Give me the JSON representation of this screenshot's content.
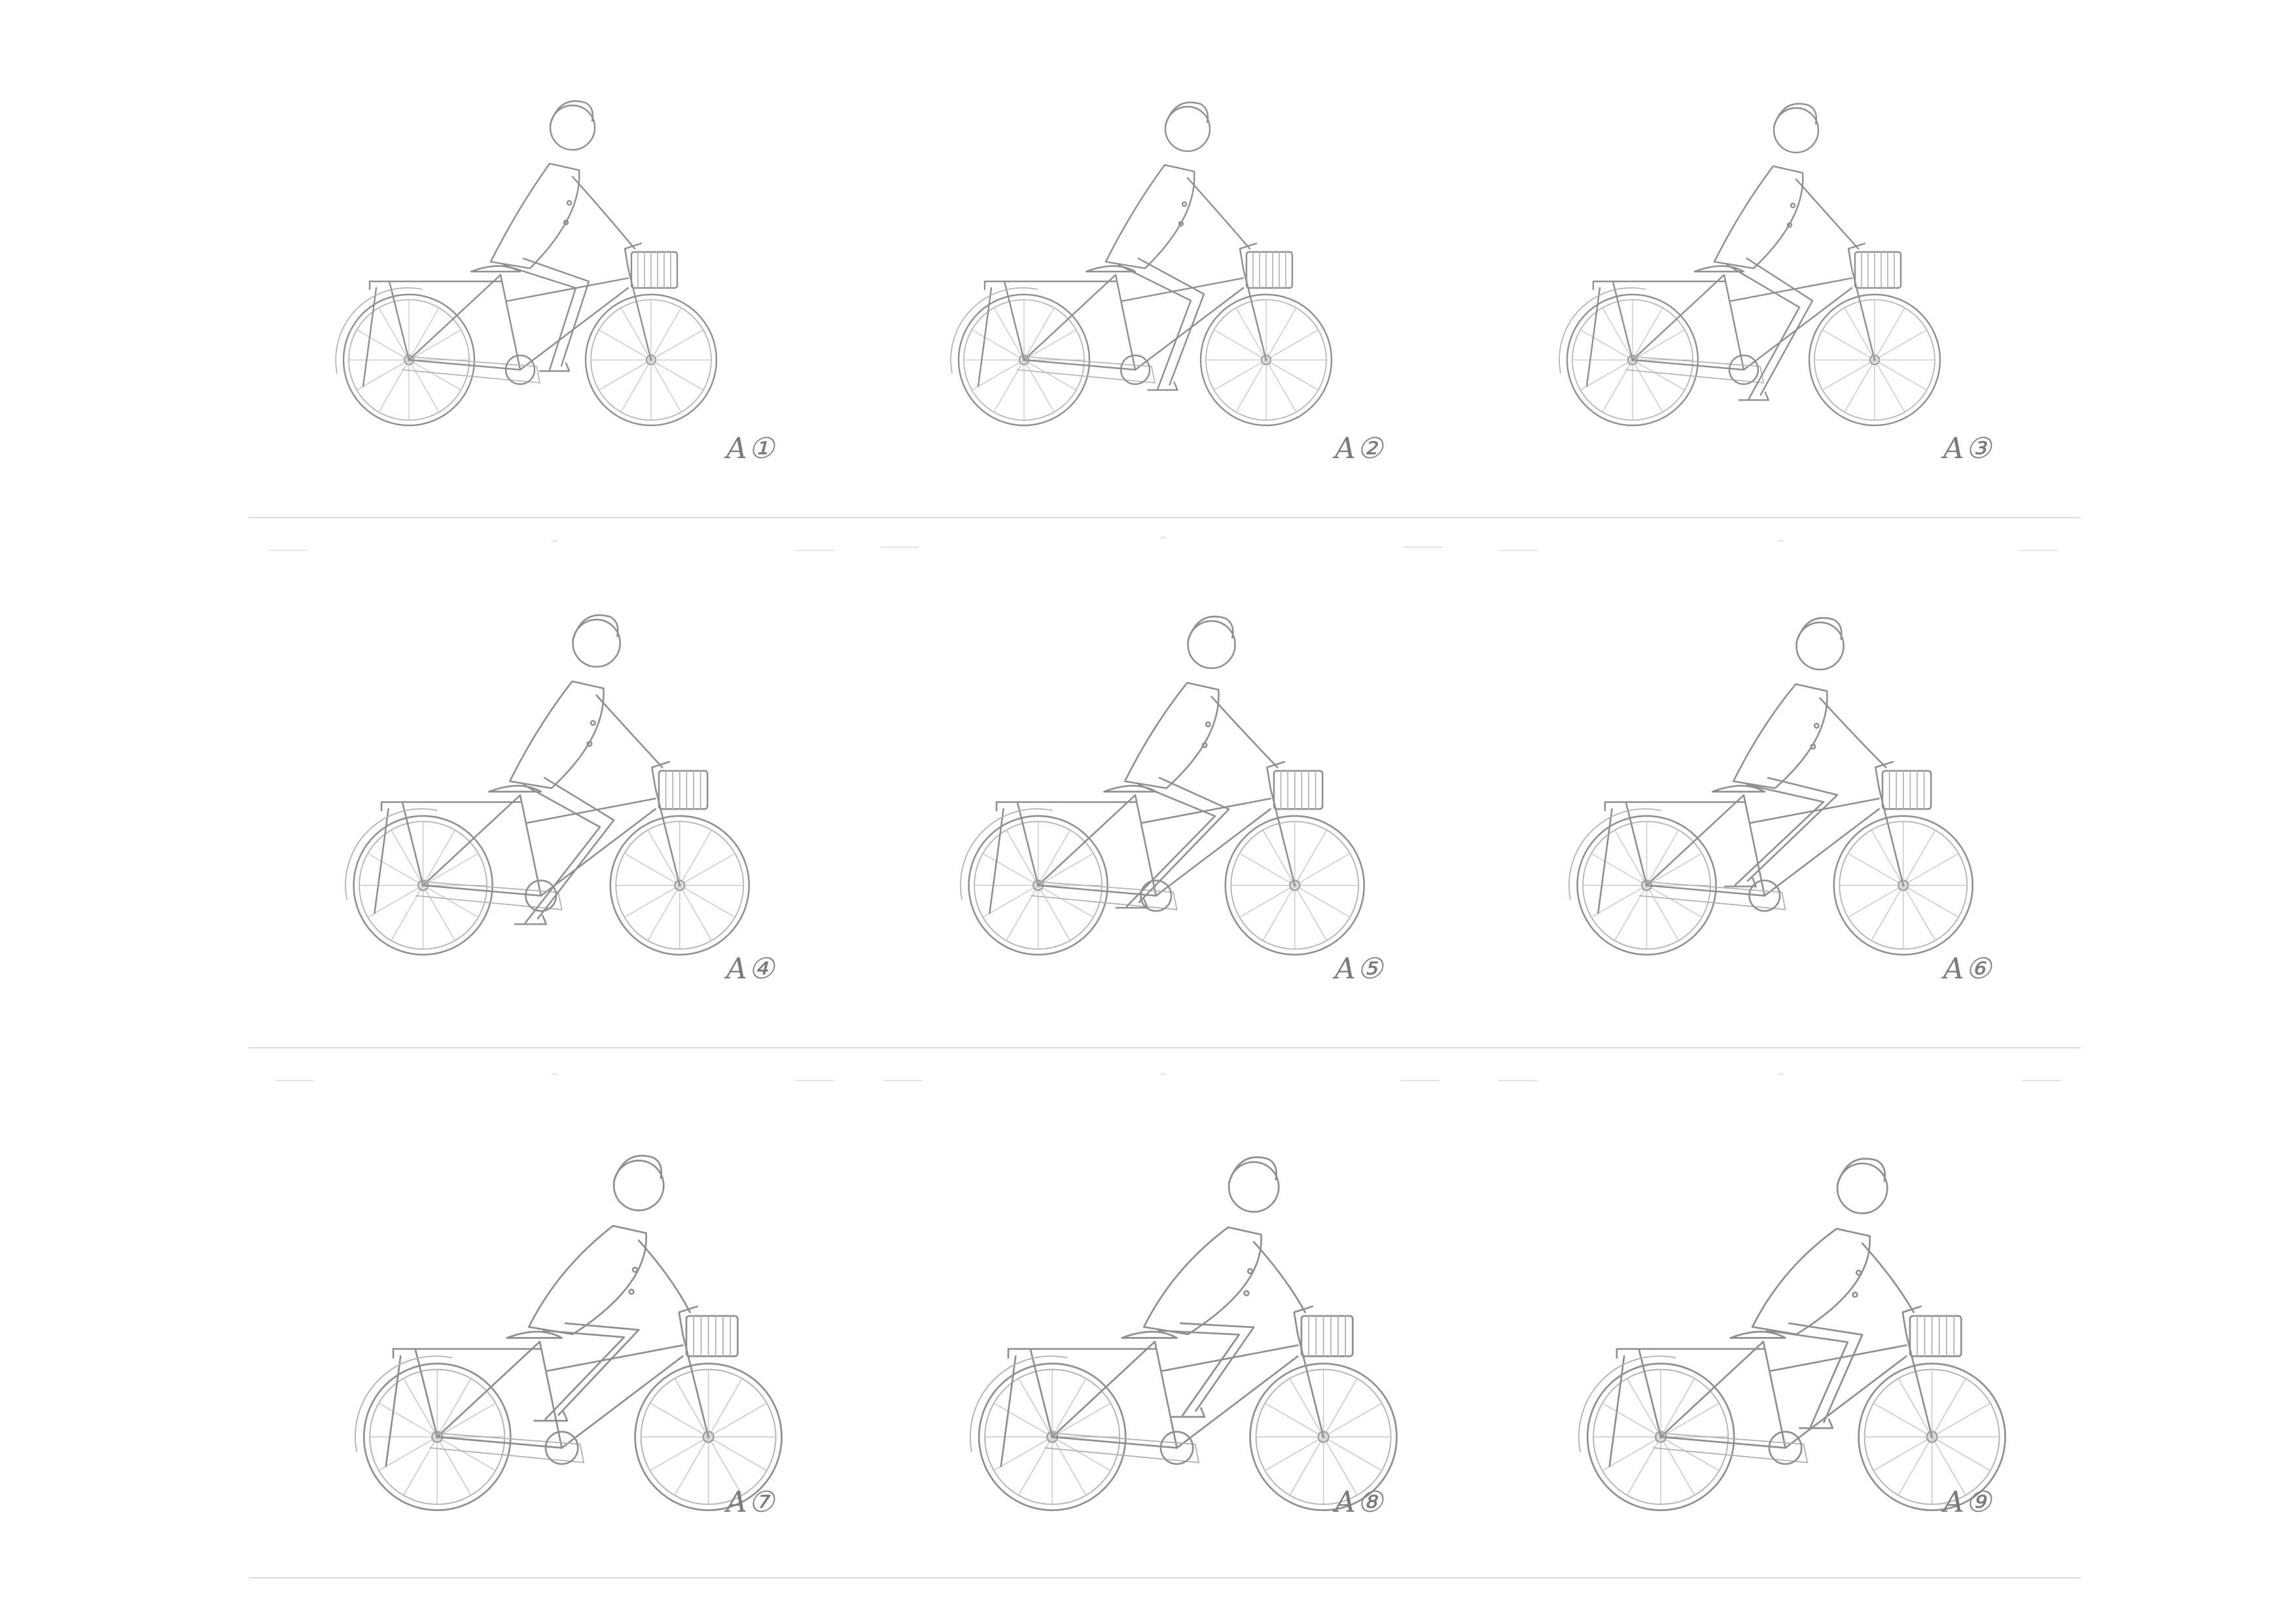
{
  "frames": [
    {
      "label": "A①",
      "pose": 0
    },
    {
      "label": "A②",
      "pose": 1
    },
    {
      "label": "A③",
      "pose": 2
    },
    {
      "label": "A④",
      "pose": 3
    },
    {
      "label": "A⑤",
      "pose": 4
    },
    {
      "label": "A⑥",
      "pose": 5
    },
    {
      "label": "A⑦",
      "pose": 6
    },
    {
      "label": "A⑧",
      "pose": 7
    },
    {
      "label": "A⑨",
      "pose": 8
    }
  ],
  "colors": {
    "paper": "#ffffff",
    "pencil": "#8f8f8f",
    "rule": "#dadada"
  },
  "icons": {
    "figure": "cyclist-on-bicycle-sketch"
  }
}
